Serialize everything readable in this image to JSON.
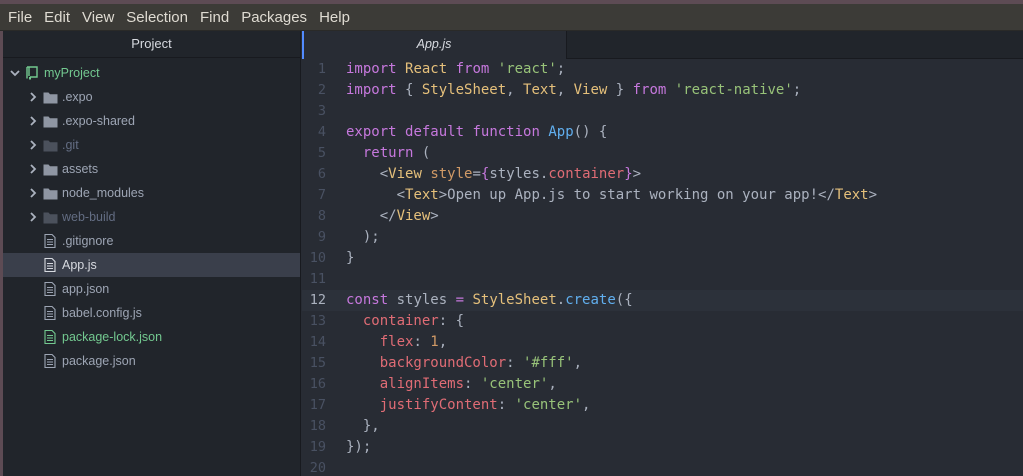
{
  "menu": [
    "File",
    "Edit",
    "View",
    "Selection",
    "Find",
    "Packages",
    "Help"
  ],
  "sidebar": {
    "title": "Project",
    "items": [
      {
        "label": "myProject",
        "kind": "root",
        "icon": "repo-icon",
        "chevron": "down",
        "indent": 0,
        "state": "root"
      },
      {
        "label": ".expo",
        "kind": "folder",
        "icon": "folder-icon",
        "chevron": "right",
        "indent": 1,
        "state": "normal"
      },
      {
        "label": ".expo-shared",
        "kind": "folder",
        "icon": "folder-icon",
        "chevron": "right",
        "indent": 1,
        "state": "normal"
      },
      {
        "label": ".git",
        "kind": "folder",
        "icon": "folder-icon",
        "chevron": "right",
        "indent": 1,
        "state": "ignored"
      },
      {
        "label": "assets",
        "kind": "folder",
        "icon": "folder-icon",
        "chevron": "right",
        "indent": 1,
        "state": "normal"
      },
      {
        "label": "node_modules",
        "kind": "folder",
        "icon": "folder-icon",
        "chevron": "right",
        "indent": 1,
        "state": "normal"
      },
      {
        "label": "web-build",
        "kind": "folder",
        "icon": "folder-icon",
        "chevron": "right",
        "indent": 1,
        "state": "ignored"
      },
      {
        "label": ".gitignore",
        "kind": "file",
        "icon": "file-icon",
        "chevron": "",
        "indent": 1,
        "state": "normal"
      },
      {
        "label": "App.js",
        "kind": "file",
        "icon": "file-icon",
        "chevron": "",
        "indent": 1,
        "state": "selected"
      },
      {
        "label": "app.json",
        "kind": "file",
        "icon": "file-icon",
        "chevron": "",
        "indent": 1,
        "state": "normal"
      },
      {
        "label": "babel.config.js",
        "kind": "file",
        "icon": "file-icon",
        "chevron": "",
        "indent": 1,
        "state": "normal"
      },
      {
        "label": "package-lock.json",
        "kind": "file",
        "icon": "file-icon",
        "chevron": "",
        "indent": 1,
        "state": "added"
      },
      {
        "label": "package.json",
        "kind": "file",
        "icon": "file-icon",
        "chevron": "",
        "indent": 1,
        "state": "normal"
      }
    ]
  },
  "tabs": [
    {
      "label": "App.js",
      "active": true
    }
  ],
  "editor": {
    "cursor_line": 12,
    "lines": [
      {
        "n": "1",
        "tokens": [
          [
            "k",
            "import"
          ],
          [
            "p",
            " "
          ],
          [
            "c",
            "React"
          ],
          [
            "p",
            " "
          ],
          [
            "k",
            "from"
          ],
          [
            "p",
            " "
          ],
          [
            "s",
            "'react'"
          ],
          [
            "p",
            ";"
          ]
        ]
      },
      {
        "n": "2",
        "tokens": [
          [
            "k",
            "import"
          ],
          [
            "p",
            " { "
          ],
          [
            "c",
            "StyleSheet"
          ],
          [
            "p",
            ", "
          ],
          [
            "c",
            "Text"
          ],
          [
            "p",
            ", "
          ],
          [
            "c",
            "View"
          ],
          [
            "p",
            " } "
          ],
          [
            "k",
            "from"
          ],
          [
            "p",
            " "
          ],
          [
            "s",
            "'react-native'"
          ],
          [
            "p",
            ";"
          ]
        ]
      },
      {
        "n": "3",
        "tokens": []
      },
      {
        "n": "4",
        "tokens": [
          [
            "k",
            "export"
          ],
          [
            "p",
            " "
          ],
          [
            "k",
            "default"
          ],
          [
            "p",
            " "
          ],
          [
            "k",
            "function"
          ],
          [
            "p",
            " "
          ],
          [
            "f",
            "App"
          ],
          [
            "p",
            "() {"
          ]
        ]
      },
      {
        "n": "5",
        "tokens": [
          [
            "p",
            "  "
          ],
          [
            "k",
            "return"
          ],
          [
            "p",
            " ("
          ]
        ]
      },
      {
        "n": "6",
        "tokens": [
          [
            "p",
            "    <"
          ],
          [
            "c",
            "View"
          ],
          [
            "p",
            " "
          ],
          [
            "n",
            "style"
          ],
          [
            "p",
            "="
          ],
          [
            "k",
            "{"
          ],
          [
            "p",
            "styles."
          ],
          [
            "t",
            "container"
          ],
          [
            "k",
            "}"
          ],
          [
            "p",
            ">"
          ]
        ]
      },
      {
        "n": "7",
        "tokens": [
          [
            "p",
            "      <"
          ],
          [
            "c",
            "Text"
          ],
          [
            "p",
            ">Open up App.js to start working on your app!</"
          ],
          [
            "c",
            "Text"
          ],
          [
            "p",
            ">"
          ]
        ]
      },
      {
        "n": "8",
        "tokens": [
          [
            "p",
            "    </"
          ],
          [
            "c",
            "View"
          ],
          [
            "p",
            ">"
          ]
        ]
      },
      {
        "n": "9",
        "tokens": [
          [
            "p",
            "  );"
          ]
        ]
      },
      {
        "n": "10",
        "tokens": [
          [
            "p",
            "}"
          ]
        ]
      },
      {
        "n": "11",
        "tokens": []
      },
      {
        "n": "12",
        "tokens": [
          [
            "k",
            "const"
          ],
          [
            "p",
            " styles "
          ],
          [
            "k",
            "="
          ],
          [
            "p",
            " "
          ],
          [
            "c",
            "StyleSheet"
          ],
          [
            "p",
            "."
          ],
          [
            "f",
            "create"
          ],
          [
            "p",
            "({"
          ]
        ]
      },
      {
        "n": "13",
        "tokens": [
          [
            "p",
            "  "
          ],
          [
            "t",
            "container"
          ],
          [
            "p",
            ": {"
          ]
        ]
      },
      {
        "n": "14",
        "tokens": [
          [
            "p",
            "    "
          ],
          [
            "t",
            "flex"
          ],
          [
            "p",
            ": "
          ],
          [
            "n",
            "1"
          ],
          [
            "p",
            ","
          ]
        ]
      },
      {
        "n": "15",
        "tokens": [
          [
            "p",
            "    "
          ],
          [
            "t",
            "backgroundColor"
          ],
          [
            "p",
            ": "
          ],
          [
            "s",
            "'#fff'"
          ],
          [
            "p",
            ","
          ]
        ]
      },
      {
        "n": "16",
        "tokens": [
          [
            "p",
            "    "
          ],
          [
            "t",
            "alignItems"
          ],
          [
            "p",
            ": "
          ],
          [
            "s",
            "'center'"
          ],
          [
            "p",
            ","
          ]
        ]
      },
      {
        "n": "17",
        "tokens": [
          [
            "p",
            "    "
          ],
          [
            "t",
            "justifyContent"
          ],
          [
            "p",
            ": "
          ],
          [
            "s",
            "'center'"
          ],
          [
            "p",
            ","
          ]
        ]
      },
      {
        "n": "18",
        "tokens": [
          [
            "p",
            "  },"
          ]
        ]
      },
      {
        "n": "19",
        "tokens": [
          [
            "p",
            "});"
          ]
        ]
      },
      {
        "n": "20",
        "tokens": []
      }
    ]
  },
  "colors": {
    "folder": "#8f96a3",
    "file": "#9da5b4",
    "accent": "#528bff",
    "green": "#73c990"
  }
}
